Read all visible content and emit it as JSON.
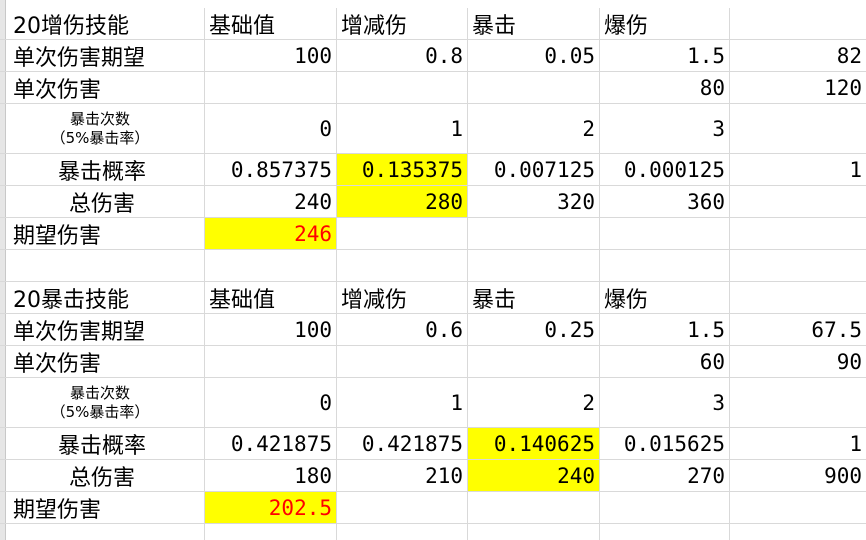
{
  "block1": {
    "header": [
      "20增伤技能",
      "基础值",
      "增减伤",
      "暴击",
      "爆伤",
      ""
    ],
    "r1": {
      "label": "单次伤害期望",
      "v": [
        "100",
        "0.8",
        "0.05",
        "1.5",
        "82"
      ]
    },
    "r2": {
      "label": "单次伤害",
      "v": [
        "",
        "",
        "",
        "80",
        "120"
      ]
    },
    "r3": {
      "label_line1": "暴击次数",
      "label_line2": "（5%暴击率）",
      "v": [
        "0",
        "1",
        "2",
        "3",
        ""
      ]
    },
    "r4": {
      "label": "暴击概率",
      "v": [
        "0.857375",
        "0.135375",
        "0.007125",
        "0.000125",
        "1"
      ]
    },
    "r5": {
      "label": "总伤害",
      "v": [
        "240",
        "280",
        "320",
        "360",
        ""
      ]
    },
    "r6": {
      "label": "期望伤害",
      "v": [
        "246",
        "",
        "",
        "",
        ""
      ]
    }
  },
  "block2": {
    "header": [
      "20暴击技能",
      "基础值",
      "增减伤",
      "暴击",
      "爆伤",
      ""
    ],
    "r1": {
      "label": "单次伤害期望",
      "v": [
        "100",
        "0.6",
        "0.25",
        "1.5",
        "67.5"
      ]
    },
    "r2": {
      "label": "单次伤害",
      "v": [
        "",
        "",
        "",
        "60",
        "90"
      ]
    },
    "r3": {
      "label_line1": "暴击次数",
      "label_line2": "（5%暴击率）",
      "v": [
        "0",
        "1",
        "2",
        "3",
        ""
      ]
    },
    "r4": {
      "label": "暴击概率",
      "v": [
        "0.421875",
        "0.421875",
        "0.140625",
        "0.015625",
        "1"
      ]
    },
    "r5": {
      "label": "总伤害",
      "v": [
        "180",
        "210",
        "240",
        "270",
        "900"
      ]
    },
    "r6": {
      "label": "期望伤害",
      "v": [
        "202.5",
        "",
        "",
        "",
        ""
      ]
    }
  },
  "colors": {
    "highlight": "#ffff00",
    "accent_text": "#ff0000",
    "gridline": "#d9d9d9"
  }
}
